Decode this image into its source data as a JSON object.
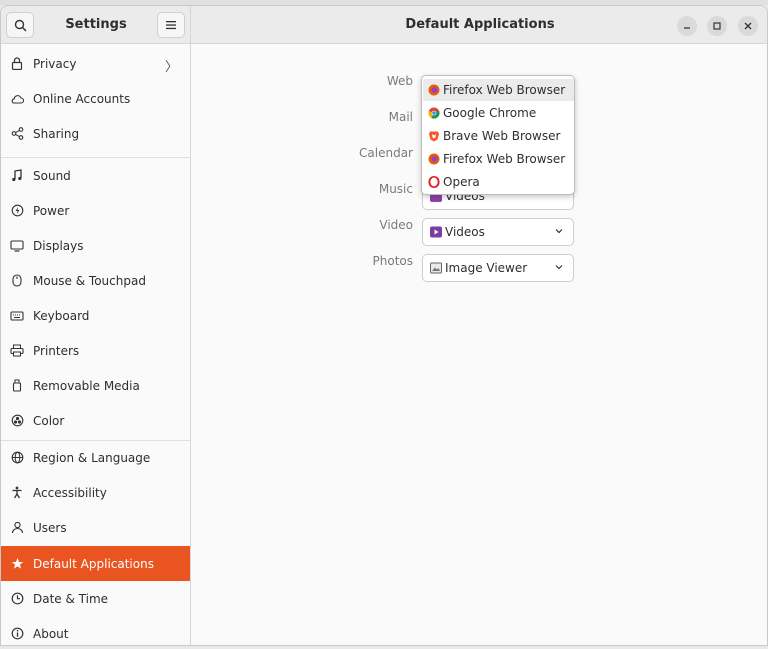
{
  "header": {
    "left_title": "Settings",
    "right_title": "Default Applications"
  },
  "sidebar": {
    "items": [
      {
        "label": "Privacy",
        "icon": "lock-icon"
      },
      {
        "label": "Online Accounts",
        "icon": "cloud-icon"
      },
      {
        "label": "Sharing",
        "icon": "share-icon"
      },
      {
        "label": "Sound",
        "icon": "music-note-icon"
      },
      {
        "label": "Power",
        "icon": "power-icon"
      },
      {
        "label": "Displays",
        "icon": "display-icon"
      },
      {
        "label": "Mouse & Touchpad",
        "icon": "mouse-icon"
      },
      {
        "label": "Keyboard",
        "icon": "keyboard-icon"
      },
      {
        "label": "Printers",
        "icon": "printer-icon"
      },
      {
        "label": "Removable Media",
        "icon": "usb-drive-icon"
      },
      {
        "label": "Color",
        "icon": "color-icon"
      },
      {
        "label": "Region & Language",
        "icon": "globe-icon"
      },
      {
        "label": "Accessibility",
        "icon": "accessibility-icon"
      },
      {
        "label": "Users",
        "icon": "user-icon"
      },
      {
        "label": "Default Applications",
        "icon": "star-icon"
      },
      {
        "label": "Date & Time",
        "icon": "clock-icon"
      },
      {
        "label": "About",
        "icon": "info-icon"
      }
    ],
    "active": "Default Applications"
  },
  "defaults": {
    "rows": [
      {
        "label": "Web",
        "value": "Firefox Web Browser"
      },
      {
        "label": "Mail",
        "value": ""
      },
      {
        "label": "Calendar",
        "value": ""
      },
      {
        "label": "Music",
        "value": "Videos"
      },
      {
        "label": "Video",
        "value": "Videos"
      },
      {
        "label": "Photos",
        "value": "Image Viewer"
      }
    ]
  },
  "web_popover": {
    "options": [
      "Firefox Web Browser",
      "Google Chrome",
      "Brave Web Browser",
      "Firefox Web Browser",
      "Opera"
    ],
    "highlighted": "Firefox Web Browser"
  },
  "colors": {
    "accent": "#e95420"
  }
}
